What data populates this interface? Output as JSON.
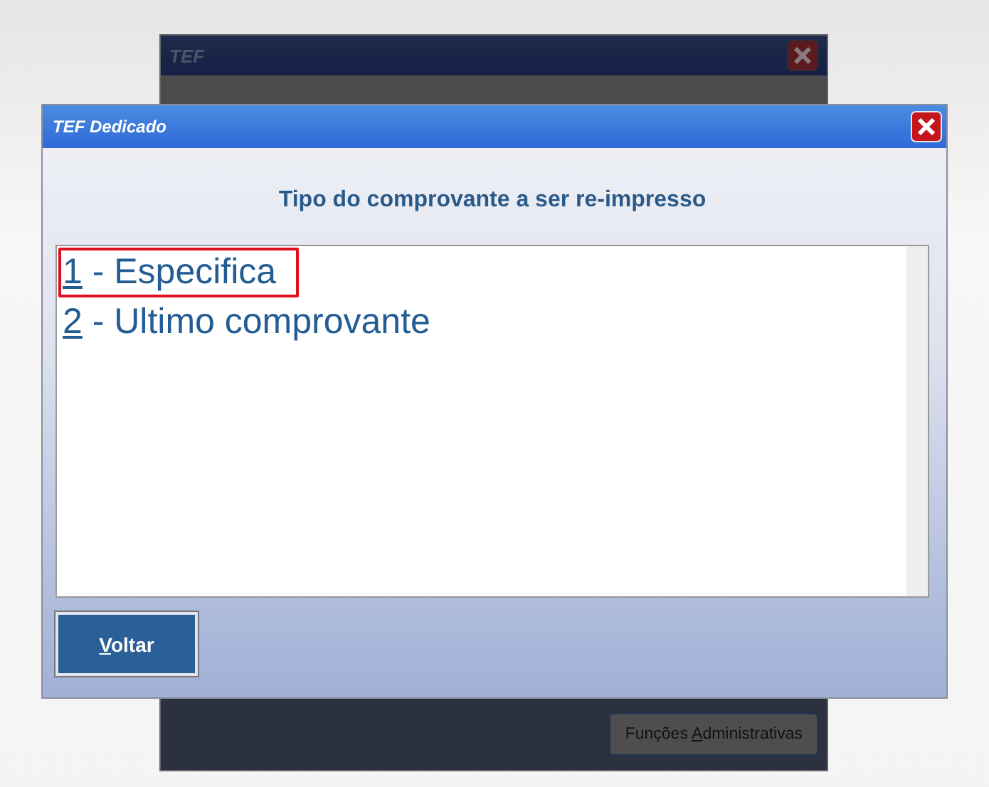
{
  "back_window": {
    "title": "TEF",
    "button": {
      "prefix": "Funções ",
      "mnemonic": "A",
      "rest": "dministrativas"
    }
  },
  "dialog": {
    "title": "TEF Dedicado",
    "heading": "Tipo do comprovante a ser re-impresso",
    "options": [
      {
        "key": "1",
        "text": " - Especifica",
        "selected": true
      },
      {
        "key": "2",
        "text": " - Ultimo comprovante",
        "selected": false
      }
    ],
    "button": {
      "mnemonic": "V",
      "rest": "oltar"
    }
  }
}
